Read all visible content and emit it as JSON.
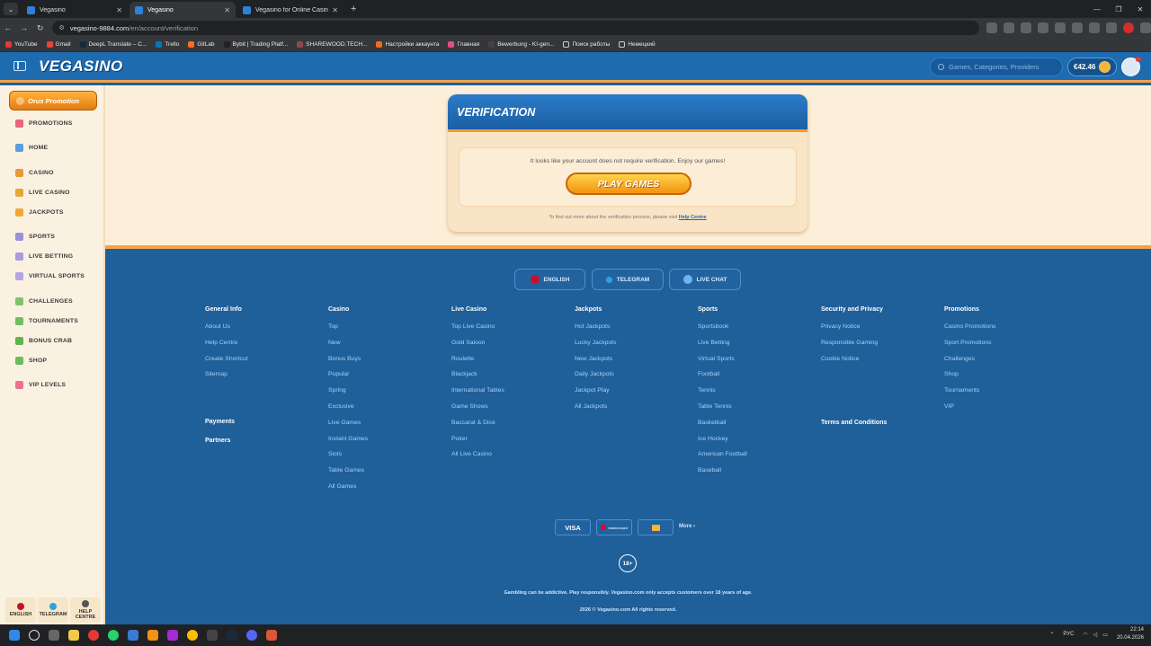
{
  "browser": {
    "tabs": [
      {
        "label": "Vegasino",
        "active": false
      },
      {
        "label": "Vegasino",
        "active": true
      },
      {
        "label": "Vegasino for Online Casino and",
        "active": false
      }
    ],
    "url_host": "vegasino-9884.com",
    "url_path": "/en/account/verification",
    "bookmarks": [
      "YouTube",
      "Gmail",
      "DeepL Translate – C...",
      "Trello",
      "GitLab",
      "Bybit | Trading Platf...",
      "SHAREWOOD.TECH...",
      "Настройки аккаунта",
      "Главная",
      "Bewerbung - KI-gen...",
      "Поиск работы",
      "Немецкий"
    ]
  },
  "header": {
    "logo": "VEGASINO",
    "search_placeholder": "Games, Categories, Providers",
    "balance": "€42.46"
  },
  "sidebar": {
    "promo_button": "Orus Promotion",
    "items": [
      {
        "label": "PROMOTIONS",
        "icon": "gift-icon"
      },
      {
        "label": "HOME",
        "icon": "home-icon"
      },
      {
        "label": "CASINO",
        "icon": "casino-icon"
      },
      {
        "label": "LIVE CASINO",
        "icon": "live-casino-icon"
      },
      {
        "label": "JACKPOTS",
        "icon": "jackpot-icon"
      },
      {
        "label": "SPORTS",
        "icon": "sports-icon"
      },
      {
        "label": "LIVE BETTING",
        "icon": "live-betting-icon"
      },
      {
        "label": "VIRTUAL SPORTS",
        "icon": "virtual-sports-icon"
      },
      {
        "label": "CHALLENGES",
        "icon": "challenges-icon"
      },
      {
        "label": "TOURNAMENTS",
        "icon": "trophy-icon"
      },
      {
        "label": "BONUS CRAB",
        "icon": "crab-icon"
      },
      {
        "label": "SHOP",
        "icon": "shop-icon"
      },
      {
        "label": "VIP LEVELS",
        "icon": "diamond-icon"
      }
    ],
    "bottom": [
      {
        "label": "ENGLISH",
        "icon": "flag-uk-icon"
      },
      {
        "label": "TELEGRAM",
        "icon": "telegram-icon"
      },
      {
        "label": "HELP CENTRE",
        "icon": "help-icon"
      }
    ]
  },
  "verification": {
    "title": "VERIFICATION",
    "message": "It looks like your account does not require verification. Enjoy our games!",
    "button": "PLAY GAMES",
    "foot_text": "To find out more about the verification process, please visit ",
    "foot_link": "Help Centre"
  },
  "footer": {
    "pills": [
      "ENGLISH",
      "TELEGRAM",
      "LIVE CHAT"
    ],
    "columns": [
      {
        "heading": "General Info",
        "links": [
          "About Us",
          "Help Centre",
          "Create Shortcut",
          "Sitemap"
        ]
      },
      {
        "heading": "Casino",
        "links": [
          "Top",
          "New",
          "Bonus Buys",
          "Popular",
          "Spring",
          "Exclusive",
          "Live Games",
          "Instant Games",
          "Slots",
          "Table Games",
          "All Games"
        ]
      },
      {
        "heading": "Live Casino",
        "links": [
          "Top Live Casino",
          "Gold Saloon",
          "Roulette",
          "Blackjack",
          "International Tables",
          "Game Shows",
          "Baccarat & Dice",
          "Poker",
          "All Live Casino"
        ]
      },
      {
        "heading": "Jackpots",
        "links": [
          "Hot Jackpots",
          "Lucky Jackpots",
          "New Jackpots",
          "Daily Jackpots",
          "Jackpot Play",
          "All Jackpots"
        ]
      },
      {
        "heading": "Sports",
        "links": [
          "Sportsbook",
          "Live Betting",
          "Virtual Sports",
          "Football",
          "Tennis",
          "Table Tennis",
          "Basketball",
          "Ice Hockey",
          "American Football",
          "Baseball"
        ]
      },
      {
        "heading": "Security and Privacy",
        "links": [
          "Privacy Notice",
          "Responsible Gaming",
          "Cookie Notice"
        ]
      },
      {
        "heading": "Promotions",
        "links": [
          "Casino Promotions",
          "Sport Promotions",
          "Challenges",
          "Shop",
          "Tournaments",
          "VIP"
        ]
      }
    ],
    "payments": "Payments",
    "partners": "Partners",
    "terms": "Terms and Conditions",
    "pay_methods": [
      "VISA",
      "mastercard",
      "wallet"
    ],
    "more": "More",
    "age": "18+",
    "disclaimer": "Gambling can be addictive. Play responsibly. Vegasino.com only accepts customers over 18 years of age.",
    "copyright": "2026 © Vegasino.com All rights reserved."
  },
  "taskbar": {
    "lang": "РУС",
    "time": "22:14",
    "date": "20.04.2026"
  }
}
